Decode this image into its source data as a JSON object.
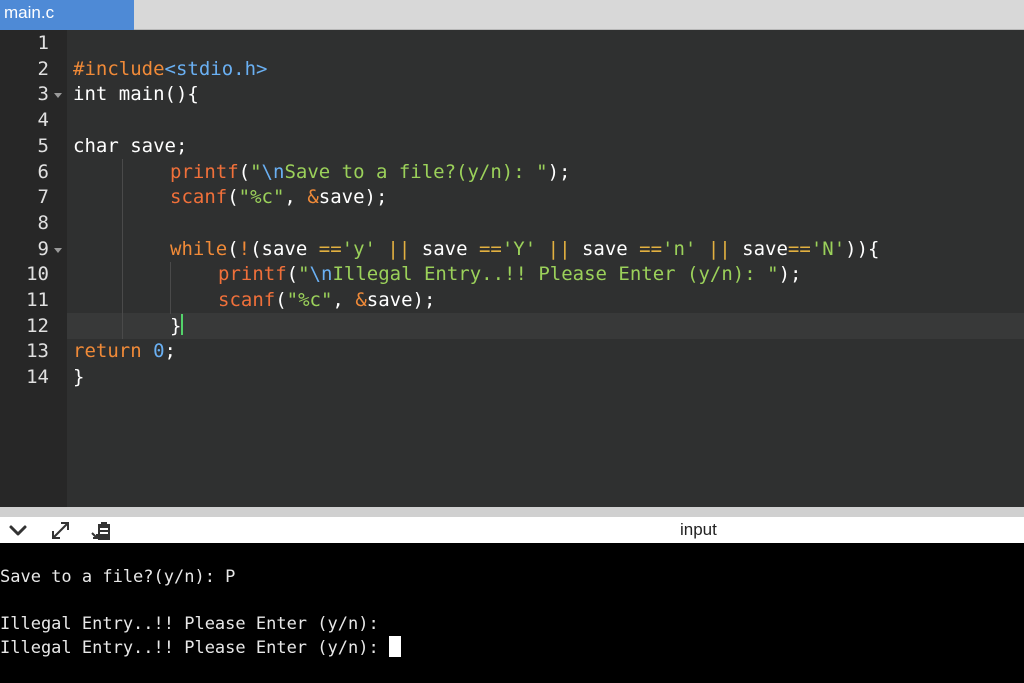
{
  "tabs": [
    {
      "label": "main.c",
      "active": true
    }
  ],
  "editor": {
    "line_numbers": [
      "1",
      "2",
      "3",
      "4",
      "5",
      "6",
      "7",
      "8",
      "9",
      "10",
      "11",
      "12",
      "13",
      "14"
    ],
    "code": {
      "l2": {
        "pre": "#include",
        "inc": "<stdio.h>"
      },
      "l3": {
        "text": "int main(){"
      },
      "l5": {
        "text": "char save;"
      },
      "l6": {
        "fn": "printf",
        "p1": "(",
        "q1": "\"",
        "esc": "\\n",
        "str": "Save to a file?(y/n): ",
        "q2": "\"",
        "p2": ");"
      },
      "l7": {
        "fn": "scanf",
        "p1": "(",
        "str": "\"%c\"",
        "p2": ", ",
        "amp": "&",
        "p3": "save);"
      },
      "l9": {
        "kw": "while",
        "p1": "(",
        "not": "!",
        "p2": "(save ",
        "eq1": "==",
        "c1": "'y'",
        "or1": "||",
        "p3": " save ",
        "eq2": "==",
        "c2": "'Y'",
        "or2": "||",
        "p4": " save ",
        "eq3": "==",
        "c3": "'n'",
        "or3": "||",
        "p5": " save",
        "eq4": "==",
        "c4": "'N'",
        "p6": ")){"
      },
      "l10": {
        "fn": "printf",
        "p1": "(",
        "q1": "\"",
        "esc": "\\n",
        "str": "Illegal Entry..!! Please Enter (y/n): ",
        "q2": "\"",
        "p2": ");"
      },
      "l11": {
        "fn": "scanf",
        "p1": "(",
        "str": "\"%c\"",
        "p2": ", ",
        "amp": "&",
        "p3": "save);"
      },
      "l12": {
        "text": "}"
      },
      "l13": {
        "kw": "return",
        "sp": " ",
        "num": "0",
        "p1": ";"
      },
      "l14": {
        "text": "}"
      }
    }
  },
  "toolbar": {
    "icons": [
      "chevron-down-icon",
      "expand-icon",
      "clipboard-icon"
    ],
    "input_label": "input"
  },
  "terminal": {
    "lines": [
      "Save to a file?(y/n): P",
      "",
      "Illegal Entry..!! Please Enter (y/n): ",
      "Illegal Entry..!! Please Enter (y/n): "
    ]
  }
}
